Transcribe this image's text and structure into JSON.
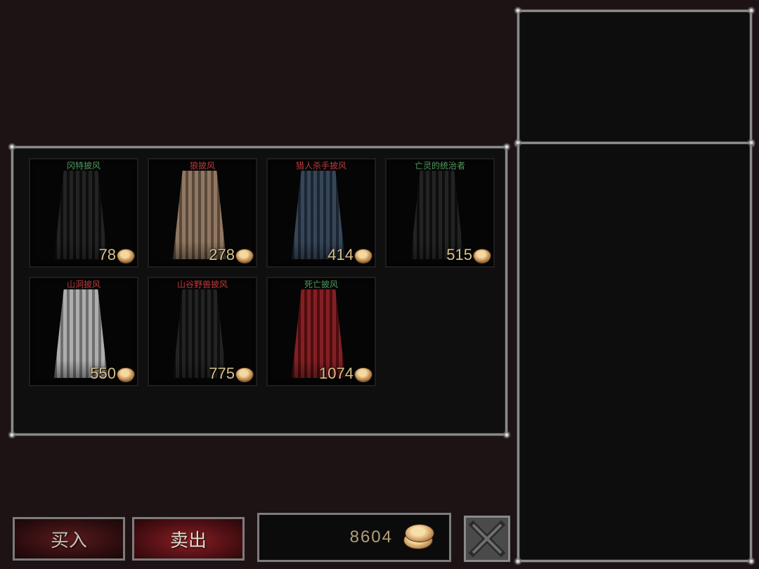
{
  "shop": {
    "items": [
      {
        "name": "冈特披风",
        "price": "78",
        "name_color": "#4f9a5e",
        "cape_color": "#151515"
      },
      {
        "name": "狼披风",
        "price": "278",
        "name_color": "#c0393a",
        "cape_color": "#8a7058"
      },
      {
        "name": "猎人杀手披风",
        "price": "414",
        "name_color": "#c0393a",
        "cape_color": "#2a3a4e"
      },
      {
        "name": "亡灵的统治者",
        "price": "515",
        "name_color": "#4f9a5e",
        "cape_color": "#151515"
      },
      {
        "name": "山洞披风",
        "price": "550",
        "name_color": "#c0393a",
        "cape_color": "#a9a9a9"
      },
      {
        "name": "山谷野兽披风",
        "price": "775",
        "name_color": "#c0393a",
        "cape_color": "#151515"
      },
      {
        "name": "死亡披风",
        "price": "1074",
        "name_color": "#4f9a5e",
        "cape_color": "#7a1216"
      }
    ]
  },
  "actions": {
    "buy_label": "买入",
    "sell_label": "卖出"
  },
  "player": {
    "gold": "8604"
  },
  "icons": {
    "coin": "coin-icon",
    "close": "close-x-icon"
  }
}
